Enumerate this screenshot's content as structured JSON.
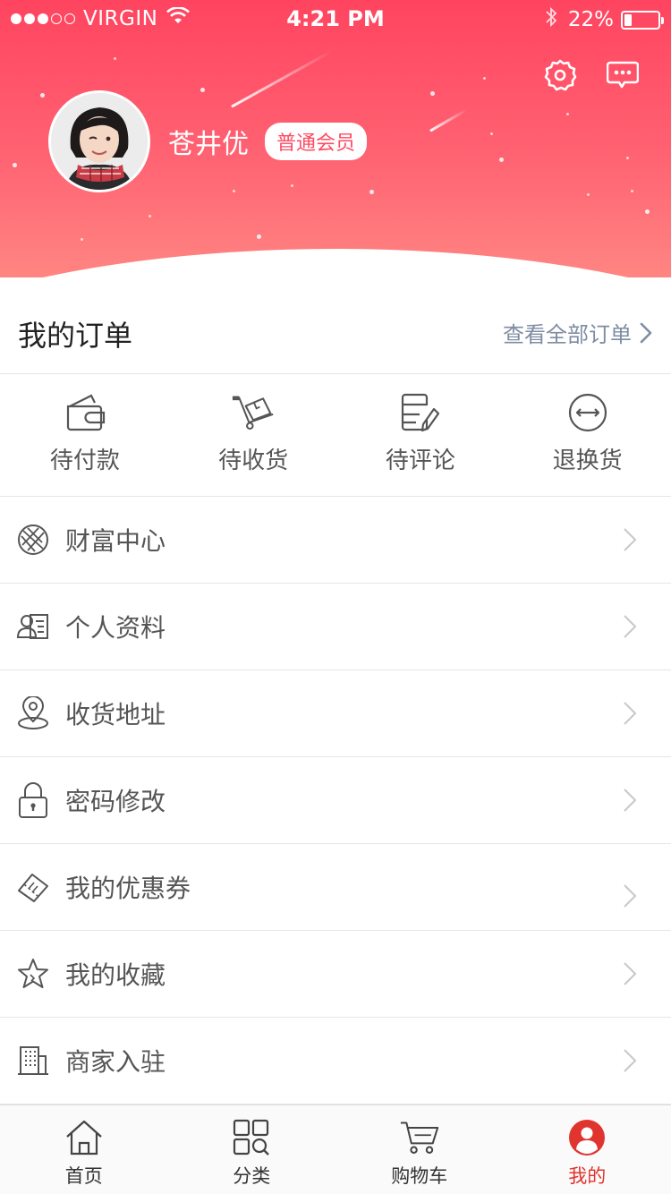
{
  "status_bar": {
    "carrier": "VIRGIN",
    "time": "4:21 PM",
    "battery": "22%",
    "battery_level": 0.22
  },
  "profile": {
    "name": "苍井优",
    "membership": "普通会员"
  },
  "orders": {
    "title": "我的订单",
    "view_all": "查看全部订单",
    "items": [
      {
        "label": "待付款",
        "icon": "wallet-icon"
      },
      {
        "label": "待收货",
        "icon": "delivery-cart-icon"
      },
      {
        "label": "待评论",
        "icon": "review-edit-icon"
      },
      {
        "label": "退换货",
        "icon": "exchange-icon"
      }
    ]
  },
  "menu": {
    "items": [
      {
        "label": "财富中心",
        "icon": "aperture-icon"
      },
      {
        "label": "个人资料",
        "icon": "profile-card-icon"
      },
      {
        "label": "收货地址",
        "icon": "location-pin-icon"
      },
      {
        "label": "密码修改",
        "icon": "lock-icon"
      },
      {
        "label": "我的优惠券",
        "icon": "coupon-icon"
      },
      {
        "label": "我的收藏",
        "icon": "star-icon"
      },
      {
        "label": "商家入驻",
        "icon": "building-icon"
      }
    ]
  },
  "tabs": [
    {
      "label": "首页",
      "icon": "home-icon"
    },
    {
      "label": "分类",
      "icon": "category-search-icon"
    },
    {
      "label": "购物车",
      "icon": "shopping-cart-icon"
    },
    {
      "label": "我的",
      "icon": "user-circle-icon",
      "active": true
    }
  ],
  "colors": {
    "header_top": "#ff4460",
    "header_bottom": "#ff8582",
    "active_tab": "#e0342f",
    "link": "#7f8ca3"
  }
}
